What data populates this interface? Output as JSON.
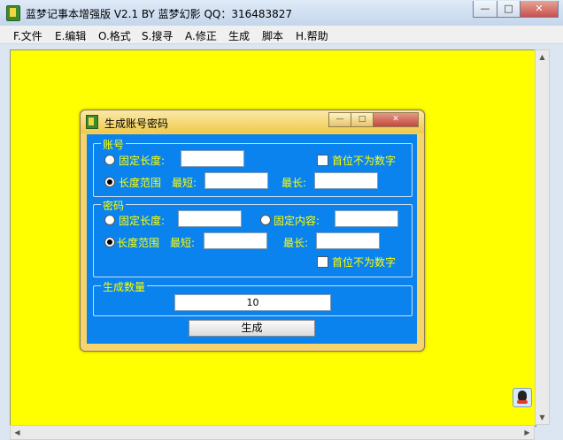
{
  "window": {
    "title": "蓝梦记事本增强版 V2.1 BY 蓝梦幻影 QQ：316483827",
    "minimize_glyph": "—",
    "maximize_glyph": "□",
    "close_glyph": "✕"
  },
  "menu": [
    {
      "label": "F.文件"
    },
    {
      "label": "E.编辑"
    },
    {
      "label": "O.格式"
    },
    {
      "label": "S.搜寻"
    },
    {
      "label": "A.修正"
    },
    {
      "label": "生成"
    },
    {
      "label": "脚本"
    },
    {
      "label": "H.帮助"
    }
  ],
  "editor": {
    "background": "#ffff00"
  },
  "dialog": {
    "title": "生成账号密码",
    "minimize_glyph": "—",
    "maximize_glyph": "□",
    "close_glyph": "✕",
    "account": {
      "legend": "账号",
      "fixed_length_label": "固定长度:",
      "fixed_length_value": "",
      "first_not_digit_label": "首位不为数字",
      "first_not_digit_checked": false,
      "range_label": "长度范围",
      "range_selected": true,
      "min_label": "最短:",
      "min_value": "",
      "max_label": "最长:",
      "max_value": ""
    },
    "password": {
      "legend": "密码",
      "fixed_length_label": "固定长度:",
      "fixed_length_value": "",
      "fixed_content_label": "固定内容:",
      "fixed_content_value": "",
      "range_label": "长度范围",
      "range_selected": true,
      "min_label": "最短:",
      "min_value": "",
      "max_label": "最长:",
      "max_value": "",
      "first_not_digit_label": "首位不为数字",
      "first_not_digit_checked": false
    },
    "count": {
      "legend": "生成数量",
      "value": "10"
    },
    "generate_button": "生成"
  },
  "colors": {
    "dialog_body": "#0b83ee",
    "label_text": "#ffff00",
    "dialog_frame": "#f6d36b"
  }
}
